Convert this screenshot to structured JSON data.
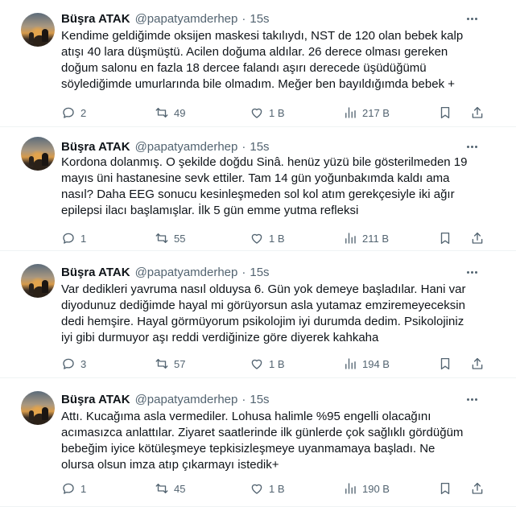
{
  "tweets": [
    {
      "name": "Büşra ATAK",
      "handle": "@papatyamderhep",
      "time": "15s",
      "lines": [
        "Kendime geldiğimde oksijen maskesi takılıydı, NST de 120 olan bebek kalp",
        "atışı 40 lara düşmüştü. Acilen doğuma aldılar. 26 derece olması gereken",
        "doğum salonu en fazla 18 dercee falandı aşırı derecede üşüdüğümü",
        "söylediğimde umurlarında bile olmadım. Meğer ben bayıldığımda bebek +"
      ],
      "replies": "2",
      "retweets": "49",
      "likes": "1 B",
      "views": "217 B"
    },
    {
      "name": "Büşra ATAK",
      "handle": "@papatyamderhep",
      "time": "15s",
      "lines": [
        "Kordona dolanmış. O şekilde doğdu Sinâ. henüz yüzü bile gösterilmeden 19",
        "mayıs üni hastanesine sevk ettiler. Tam 14 gün yoğunbakımda kaldı ama",
        "nasıl? Daha EEG sonucu kesinleşmeden sol kol atım gerekçesiyle iki ağır",
        "epilepsi ilacı başlamışlar. İlk 5 gün emme yutma refleksi"
      ],
      "replies": "1",
      "retweets": "55",
      "likes": "1 B",
      "views": "211 B"
    },
    {
      "name": "Büşra ATAK",
      "handle": "@papatyamderhep",
      "time": "15s",
      "lines": [
        "Var dedikleri yavruma nasıl olduysa 6. Gün yok demeye başladılar. Hani var",
        "diyodunuz dediğimde hayal mi görüyorsun asla yutamaz emziremeyeceksin",
        "dedi hemşire. Hayal görmüyorum psikolojim iyi durumda dedim. Psikolojiniz",
        "iyi gibi durmuyor aşı reddi verdiğinize göre diyerek kahkaha"
      ],
      "replies": "3",
      "retweets": "57",
      "likes": "1 B",
      "views": "194 B"
    },
    {
      "name": "Büşra ATAK",
      "handle": "@papatyamderhep",
      "time": "15s",
      "lines": [
        "Attı. Kucağıma asla vermediler. Lohusa halimle %95 engelli olacağını",
        "acımasızca anlattılar. Ziyaret saatlerinde ilk günlerde çok sağlıklı gördüğüm",
        "bebeğim iyice kötüleşmeye tepkisizleşmeye uyanmamaya başladı. Ne",
        "olursa olsun imza atıp çıkarmayı istedik+"
      ],
      "replies": "1",
      "retweets": "45",
      "likes": "1 B",
      "views": "190 B"
    }
  ],
  "separator": "·",
  "icons": {
    "reply": "speech-bubble-icon",
    "retweet": "retweet-arrows-icon",
    "like": "heart-icon",
    "views": "bar-chart-icon",
    "bookmark": "bookmark-icon",
    "share": "share-upload-icon",
    "more": "more-dots-icon"
  }
}
